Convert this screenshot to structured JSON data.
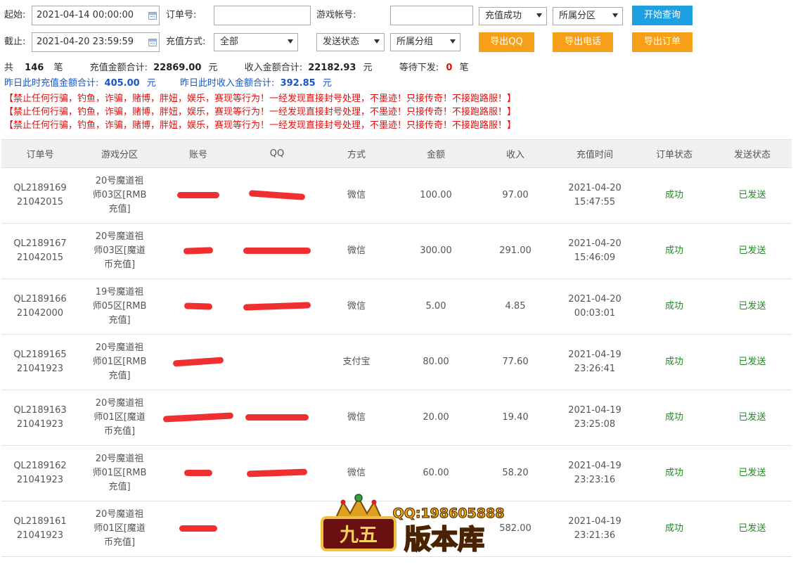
{
  "filters": {
    "start_label": "起始:",
    "start_value": "2021-04-14 00:00:00",
    "end_label": "截止:",
    "end_value": "2021-04-20 23:59:59",
    "order_label": "订单号:",
    "order_value": "",
    "account_label": "游戏帐号:",
    "account_value": "",
    "method_label": "充值方式:",
    "status_select": "充值成功",
    "zone_select": "所属分区",
    "method_select": "全部",
    "send_select": "发送状态",
    "group_select": "所属分组",
    "query_button": "开始查询",
    "export_qq": "导出QQ",
    "export_phone": "导出电话",
    "export_order": "导出订单"
  },
  "summary": {
    "total_prefix": "共",
    "total_count": "146",
    "total_unit": "笔",
    "recharge_label": "充值金额合计:",
    "recharge_value": "22869.00",
    "recharge_unit": "元",
    "income_label": "收入金额合计:",
    "income_value": "22182.93",
    "income_unit": "元",
    "pending_label": "等待下发:",
    "pending_value": "0",
    "pending_unit": "笔",
    "yday_recharge_label": "昨日此时充值金额合计:",
    "yday_recharge_value": "405.00",
    "yday_recharge_unit": "元",
    "yday_income_label": "昨日此时收入金额合计:",
    "yday_income_value": "392.85",
    "yday_income_unit": "元"
  },
  "warnings": [
    "【禁止任何行骗，钓鱼，诈骗，赌博，胖妞，娱乐，赛现等行为！一经发现直接封号处理，不墨迹！只接传奇！不接跑路服！】",
    "【禁止任何行骗，钓鱼，诈骗，赌博，胖妞，娱乐，赛现等行为！一经发现直接封号处理，不墨迹！只接传奇！不接跑路服！】",
    "【禁止任何行骗，钓鱼，诈骗，赌博，胖妞，娱乐，赛现等行为！一经发现直接封号处理，不墨迹！只接传奇！不接跑路服！】"
  ],
  "table": {
    "headers": [
      "订单号",
      "游戏分区",
      "账号",
      "QQ",
      "方式",
      "金额",
      "收入",
      "充值时间",
      "订单状态",
      "发送状态"
    ],
    "rows": [
      {
        "order1": "QL2189169",
        "order2": "21042015",
        "zone1": "20号魔道祖",
        "zone2": "师03区[RMB",
        "zone3": "充值]",
        "method": "微信",
        "amount": "100.00",
        "income": "97.00",
        "date": "2021-04-20",
        "time": "15:47:55",
        "status": "成功",
        "send": "已发送"
      },
      {
        "order1": "QL2189167",
        "order2": "21042015",
        "zone1": "20号魔道祖",
        "zone2": "师03区[魔道",
        "zone3": "币充值]",
        "method": "微信",
        "amount": "300.00",
        "income": "291.00",
        "date": "2021-04-20",
        "time": "15:46:09",
        "status": "成功",
        "send": "已发送"
      },
      {
        "order1": "QL2189166",
        "order2": "21042000",
        "zone1": "19号魔道祖",
        "zone2": "师05区[RMB",
        "zone3": "充值]",
        "method": "微信",
        "amount": "5.00",
        "income": "4.85",
        "date": "2021-04-20",
        "time": "00:03:01",
        "status": "成功",
        "send": "已发送"
      },
      {
        "order1": "QL2189165",
        "order2": "21041923",
        "zone1": "20号魔道祖",
        "zone2": "师01区[RMB",
        "zone3": "充值]",
        "method": "支付宝",
        "amount": "80.00",
        "income": "77.60",
        "date": "2021-04-19",
        "time": "23:26:41",
        "status": "成功",
        "send": "已发送"
      },
      {
        "order1": "QL2189163",
        "order2": "21041923",
        "zone1": "20号魔道祖",
        "zone2": "师01区[魔道",
        "zone3": "币充值]",
        "method": "微信",
        "amount": "20.00",
        "income": "19.40",
        "date": "2021-04-19",
        "time": "23:25:08",
        "status": "成功",
        "send": "已发送"
      },
      {
        "order1": "QL2189162",
        "order2": "21041923",
        "zone1": "20号魔道祖",
        "zone2": "师01区[RMB",
        "zone3": "充值]",
        "method": "微信",
        "amount": "60.00",
        "income": "58.20",
        "date": "2021-04-19",
        "time": "23:23:16",
        "status": "成功",
        "send": "已发送"
      },
      {
        "order1": "QL2189161",
        "order2": "21041923",
        "zone1": "20号魔道祖",
        "zone2": "师01区[魔道",
        "zone3": "币充值]",
        "method": "",
        "amount": "",
        "income": "582.00",
        "date": "2021-04-19",
        "time": "23:21:36",
        "status": "成功",
        "send": "已发送"
      }
    ]
  },
  "watermark": {
    "contact": "QQ:198605888",
    "badge": "九五",
    "name": "版本库"
  }
}
